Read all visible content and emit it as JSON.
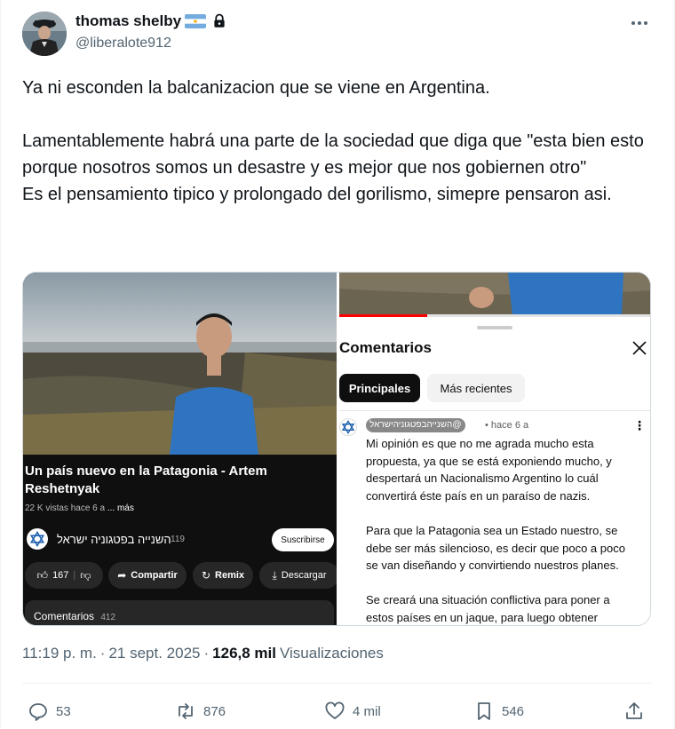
{
  "author": {
    "display_name": "thomas shelby",
    "handle": "@liberalote912",
    "icons": [
      "argentina-flag-icon",
      "lock-icon"
    ]
  },
  "tweet": {
    "text": "Ya ni esconden la balcanizacion que se viene en Argentina.\n\nLamentablemente habrá una parte de la sociedad que diga que \"esta bien esto porque nosotros somos un desastre y es mejor que nos gobiernen otro\"\nEs el pensamiento tipico y prolongado del gorilismo, simepre pensaron asi."
  },
  "media": {
    "left": {
      "video_title": "Un país nuevo en la Patagonia - Artem Reshetnyak",
      "views": "22 K vistas",
      "ago": "hace 6 a",
      "more": "... más",
      "channel_name": "השנייה בפטגוניה ישראל",
      "channel_subs": "119",
      "subscribe_label": "Suscribirse",
      "likes": "167",
      "share_label": "Compartir",
      "remix_label": "Remix",
      "download_label": "Descargar",
      "comments_label": "Comentarios",
      "comments_count": "412"
    },
    "right": {
      "title": "Comentarios",
      "chip_top": "Principales",
      "chip_recent": "Más recientes",
      "comment_user": "@השנייהבפטגוניהישראל",
      "comment_time": "• hace 6 a",
      "comment_body": "Mi opinión es que no me agrada mucho esta propuesta, ya que se está exponiendo mucho, y despertará un Nacionalismo Argentino lo cuál convertirá éste país en un paraíso de nazis.\n\nPara que la Patagonia sea un Estado nuestro, se debe ser más silencioso, es decir que poco a poco se van diseñando y convirtiendo nuestros planes.\n\nSe creará una situación conflictiva para poner a estos países en un jaque, para luego obtener",
      "progress_fraction": 0.28
    }
  },
  "meta": {
    "time": "11:19 p. m.",
    "dot": "·",
    "date": "21 sept. 2025",
    "views_count": "126,8 mil",
    "views_label": "Visualizaciones"
  },
  "stats": {
    "replies": "53",
    "reposts": "876",
    "likes": "4 mil",
    "bookmarks": "546"
  },
  "colors": {
    "text_primary": "#0f1419",
    "text_secondary": "#536471",
    "youtube_red": "#ff0000"
  }
}
